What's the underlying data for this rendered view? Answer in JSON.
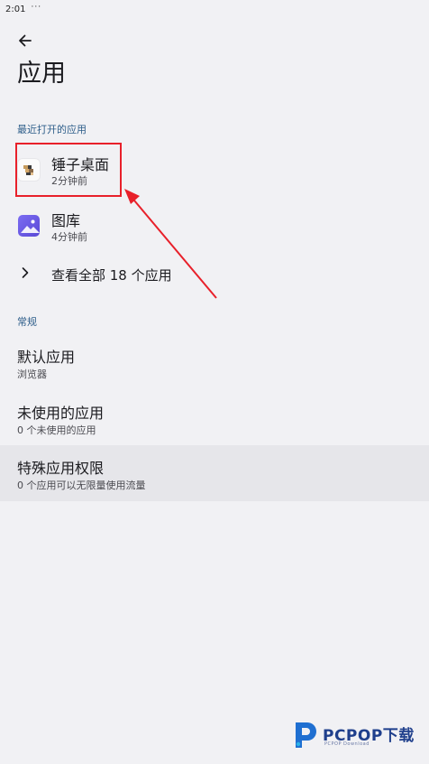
{
  "status_bar": {
    "time": "2:01",
    "more": "···"
  },
  "header": {
    "title": "应用"
  },
  "recent": {
    "section_label": "最近打开的应用",
    "apps": [
      {
        "name": "锤子桌面",
        "time": "2分钟前",
        "icon": "smartisan-launcher-icon"
      },
      {
        "name": "图库",
        "time": "4分钟前",
        "icon": "gallery-icon"
      }
    ],
    "see_all_label": "查看全部 18 个应用"
  },
  "general": {
    "section_label": "常规",
    "items": [
      {
        "title": "默认应用",
        "summary": "浏览器"
      },
      {
        "title": "未使用的应用",
        "summary": "0 个未使用的应用"
      },
      {
        "title": "特殊应用权限",
        "summary": "0 个应用可以无限量使用流量"
      }
    ]
  },
  "annotation": {
    "highlight_color": "#e8202a"
  },
  "watermark": {
    "brand": "PCPOP下载",
    "sub": "PCPOP Download"
  },
  "colors": {
    "background": "#f1f1f4",
    "section_header": "#2e5e8a",
    "selected_row": "#e6e6ea"
  }
}
